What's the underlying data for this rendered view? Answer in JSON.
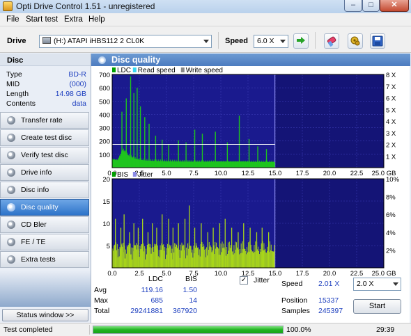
{
  "window": {
    "title": "Opti Drive Control 1.51 - unregistered",
    "controls": {
      "minimize": "–",
      "maximize": "□",
      "close": "✕"
    }
  },
  "menu": [
    "File",
    "Start test",
    "Extra",
    "Help"
  ],
  "toolbar": {
    "drive_label": "Drive",
    "drive_value": "(H:)  ATAPI iHBS112  2 CL0K",
    "speed_label": "Speed",
    "speed_value": "6.0 X",
    "icons": [
      "refresh-icon",
      "erase-icon",
      "settings-icon",
      "save-icon"
    ]
  },
  "disc": {
    "header": "Disc",
    "rows": [
      {
        "key": "Type",
        "value": "BD-R"
      },
      {
        "key": "MID",
        "value": "(000)"
      },
      {
        "key": "Length",
        "value": "14.98 GB"
      },
      {
        "key": "Contents",
        "value": "data"
      }
    ]
  },
  "nav": [
    {
      "label": "Transfer rate",
      "active": false
    },
    {
      "label": "Create test disc",
      "active": false
    },
    {
      "label": "Verify test disc",
      "active": false
    },
    {
      "label": "Drive info",
      "active": false
    },
    {
      "label": "Disc info",
      "active": false
    },
    {
      "label": "Disc quality",
      "active": true
    },
    {
      "label": "CD Bler",
      "active": false
    },
    {
      "label": "FE / TE",
      "active": false
    },
    {
      "label": "Extra tests",
      "active": false
    }
  ],
  "status_window_button": "Status window >>",
  "main_title": "Disc quality",
  "colors": {
    "plot_bg": "#1a1a8e",
    "plot_bg_unused": "#141476",
    "grid": "#3a3ab4",
    "ldc": "#1ec41e",
    "bis": "#a8d61a",
    "read_speed": "#ffffff",
    "write_speed": "#c000c0"
  },
  "chart_data": [
    {
      "type": "bar",
      "legend": [
        "LDC",
        "Read speed",
        "Write speed"
      ],
      "legend_colors": [
        "#00a000",
        "#3ad7f0",
        "#8a8a8a"
      ],
      "x_ticks": [
        "0.0",
        "2.5",
        "5.0",
        "7.5",
        "10.0",
        "12.5",
        "15.0",
        "17.5",
        "20.0",
        "22.5",
        "25.0 GB"
      ],
      "xlim": [
        0,
        25
      ],
      "ylim": [
        0,
        700
      ],
      "y_ticks": [
        "700",
        "600",
        "500",
        "400",
        "300",
        "200",
        "100"
      ],
      "y2_ticks": [
        "8 X",
        "7 X",
        "6 X",
        "5 X",
        "4 X",
        "3 X",
        "2 X",
        "1 X"
      ],
      "y2lim": [
        0,
        8
      ],
      "data_end_gb": 14.98,
      "baseline_x": [
        0,
        0.5,
        1,
        1.5,
        2,
        2.5,
        3,
        3.5,
        4,
        5,
        6,
        7,
        8,
        9,
        10,
        11,
        12,
        13,
        14,
        14.98
      ],
      "baseline_y": [
        60,
        55,
        130,
        90,
        70,
        60,
        55,
        52,
        50,
        48,
        47,
        46,
        45,
        46,
        45,
        44,
        45,
        44,
        43,
        42
      ],
      "spikes_x": [
        0.9,
        1.3,
        1.7,
        2.0,
        2.3,
        2.6,
        3.0,
        3.4,
        4.0,
        4.6,
        5.2,
        6.1,
        6.8,
        7.6,
        8.3,
        9.5,
        10.6,
        11.7,
        12.6,
        13.4,
        14.2
      ],
      "spikes_y": [
        420,
        520,
        685,
        560,
        600,
        460,
        380,
        330,
        240,
        210,
        175,
        205,
        190,
        285,
        255,
        270,
        190,
        390,
        215,
        160,
        140
      ],
      "read_speed_x": [
        0,
        2,
        4,
        6,
        8,
        10,
        12,
        14,
        14.98
      ],
      "read_speed_y": [
        2.0,
        2.0,
        2.0,
        2.0,
        2.0,
        2.0,
        2.0,
        2.0,
        2.0
      ]
    },
    {
      "type": "bar",
      "legend": [
        "BIS",
        "Jitter"
      ],
      "legend_colors": [
        "#00a000",
        "#8a8ae6"
      ],
      "x_ticks": [
        "0.0",
        "2.5",
        "5.0",
        "7.5",
        "10.0",
        "12.5",
        "15.0",
        "17.5",
        "20.0",
        "22.5",
        "25.0 GB"
      ],
      "xlim": [
        0,
        25
      ],
      "ylim": [
        0,
        20
      ],
      "y_ticks": [
        "20",
        "15",
        "10",
        "5"
      ],
      "y2_ticks": [
        "10%",
        "8%",
        "6%",
        "4%",
        "2%"
      ],
      "data_end_gb": 14.98,
      "peaks_x": [
        0.3,
        0.8,
        1.1,
        1.6,
        2.0,
        2.4,
        2.8,
        3.3,
        3.7,
        4.1,
        4.6,
        5.2,
        5.6,
        6.1,
        6.7,
        7.1,
        7.6,
        8.2,
        8.8,
        9.3,
        9.9,
        10.4,
        11.0,
        11.6,
        12.1,
        12.7,
        13.3,
        13.8,
        14.4
      ],
      "peaks_y": [
        11,
        9,
        12,
        8,
        10,
        9,
        11,
        8,
        10,
        9,
        12,
        11,
        9,
        10,
        11,
        14,
        9,
        10,
        8,
        9,
        10,
        11,
        9,
        8,
        10,
        9,
        8,
        9,
        8
      ]
    }
  ],
  "stats": {
    "headers": {
      "ldc": "LDC",
      "bis": "BIS"
    },
    "rows": [
      {
        "label": "Avg",
        "ldc": "119.16",
        "bis": "1.50"
      },
      {
        "label": "Max",
        "ldc": "685",
        "bis": "14"
      },
      {
        "label": "Total",
        "ldc": "29241881",
        "bis": "367920"
      }
    ],
    "jitter_label": "Jitter",
    "jitter_checked": true,
    "speed_label": "Speed",
    "speed_value": "2.01 X",
    "speed_select": "2.0 X",
    "position_label": "Position",
    "position_value": "15337",
    "samples_label": "Samples",
    "samples_value": "245397",
    "start_label": "Start"
  },
  "statusbar": {
    "text": "Test completed",
    "progress": 1.0,
    "percent": "100.0%",
    "time": "29:39"
  }
}
